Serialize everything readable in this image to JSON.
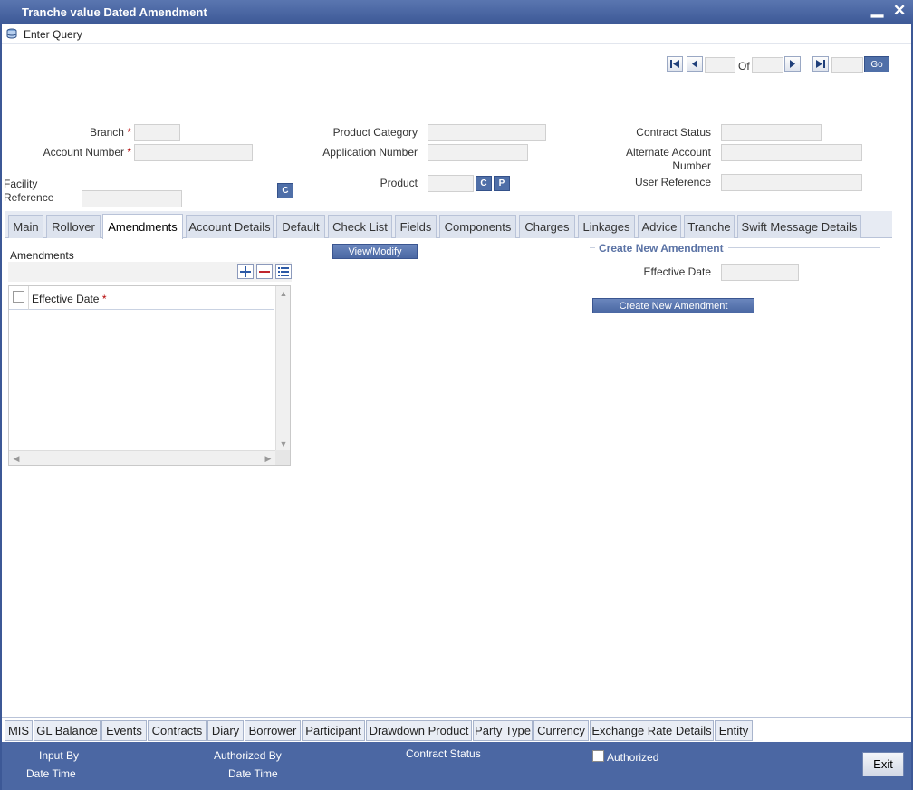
{
  "window": {
    "title": "Tranche value Dated Amendment",
    "minimize_glyph": "▁",
    "close_glyph": "✕"
  },
  "toolbar": {
    "enter_query": "Enter Query"
  },
  "navigator": {
    "of_label": "Of",
    "go_label": "Go"
  },
  "form": {
    "branch_label": "Branch",
    "account_number_label": "Account Number",
    "facility_reference_label": "Facility Reference",
    "product_category_label": "Product Category",
    "application_number_label": "Application Number",
    "product_label": "Product",
    "contract_status_label": "Contract Status",
    "alternate_account_label": "Alternate Account Number",
    "user_reference_label": "User Reference",
    "required_mark": "*",
    "c_button": "C",
    "p_button": "P"
  },
  "tabs": [
    {
      "label": "Main"
    },
    {
      "label": "Rollover"
    },
    {
      "label": "Amendments",
      "active": true
    },
    {
      "label": "Account Details"
    },
    {
      "label": "Default"
    },
    {
      "label": "Check List"
    },
    {
      "label": "Fields"
    },
    {
      "label": "Components"
    },
    {
      "label": "Charges"
    },
    {
      "label": "Linkages"
    },
    {
      "label": "Advice"
    },
    {
      "label": "Tranche"
    },
    {
      "label": "Swift Message Details"
    }
  ],
  "amendments": {
    "section_title": "Amendments",
    "column_effective_date": "Effective Date",
    "view_modify_button": "View/Modify"
  },
  "create_amendment": {
    "section_title": "Create New Amendment",
    "effective_date_label": "Effective Date",
    "button_label": "Create New Amendment"
  },
  "bottom_tabs": [
    {
      "label": "MIS"
    },
    {
      "label": "GL Balance"
    },
    {
      "label": "Events"
    },
    {
      "label": "Contracts"
    },
    {
      "label": "Diary"
    },
    {
      "label": "Borrower"
    },
    {
      "label": "Participant"
    },
    {
      "label": "Drawdown Product"
    },
    {
      "label": "Party Type"
    },
    {
      "label": "Currency"
    },
    {
      "label": "Exchange Rate Details"
    },
    {
      "label": "Entity"
    }
  ],
  "footer": {
    "input_by": "Input By",
    "date_time_1": "Date Time",
    "authorized_by": "Authorized By",
    "date_time_2": "Date Time",
    "contract_status": "Contract Status",
    "authorized": "Authorized",
    "exit": "Exit"
  },
  "colors": {
    "title_bar": "#3c5896",
    "footer": "#4b67a3",
    "accent_button": "#4f6fa8",
    "required": "#b30000"
  }
}
